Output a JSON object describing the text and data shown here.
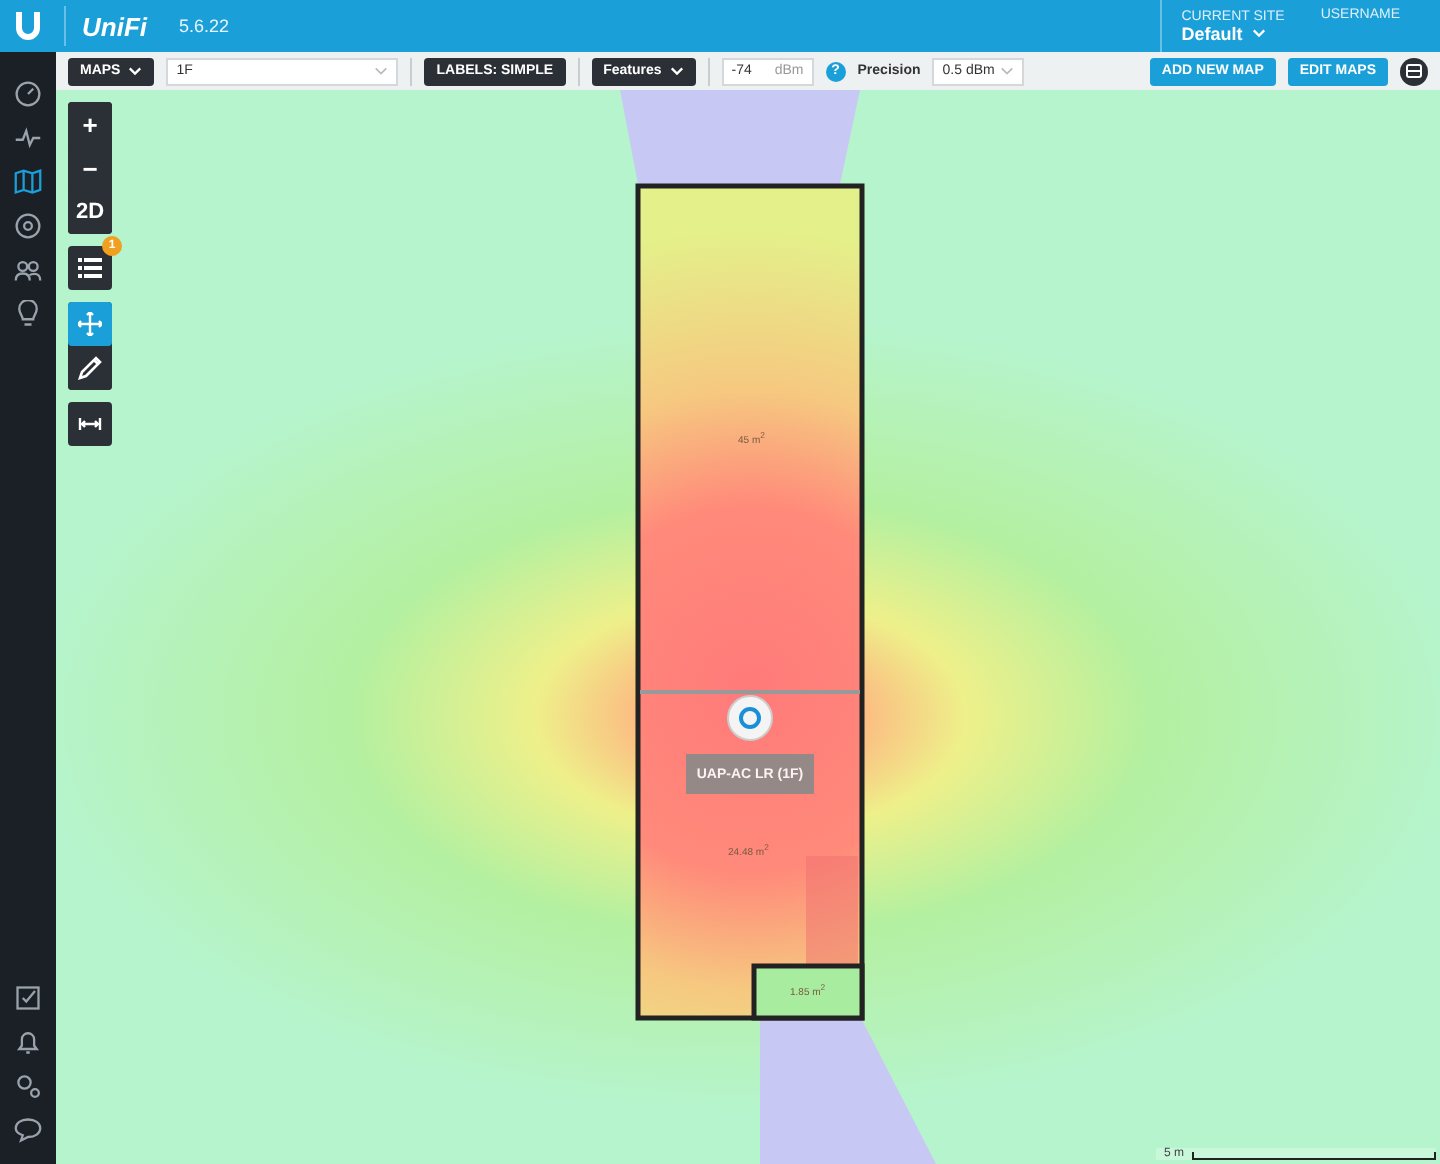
{
  "header": {
    "logo": "UniFi",
    "version": "5.6.22",
    "site_label": "CURRENT SITE",
    "site": "Default",
    "user_label": "USERNAME"
  },
  "nav_top": [
    {
      "selected": false
    },
    {
      "selected": false
    },
    {
      "selected": true
    },
    {
      "selected": false
    },
    {
      "selected": false
    },
    {
      "selected": false
    }
  ],
  "nav_bottom": [
    {
      "selected": false
    },
    {
      "selected": false
    },
    {
      "selected": false
    },
    {
      "selected": false
    }
  ],
  "toolbar": {
    "maps": "MAPS",
    "floor": "1F",
    "labels": "LABELS: SIMPLE",
    "features": "Features",
    "signal": "-74",
    "signal_unit": "dBm",
    "help": "?",
    "precision_label": "Precision",
    "precision": "0.5 dBm",
    "add_map": "ADD NEW MAP",
    "edit_maps": "EDIT MAPS"
  },
  "map_tools": {
    "zoom_in": "+",
    "zoom_out": "−",
    "view": "2D",
    "list_badge": "1",
    "move_selected": true,
    "draw_selected": false
  },
  "rooms": [
    {
      "area": "45 m$^{2}$"
    },
    {
      "area": "24.48 m$^{2}$"
    },
    {
      "area": "1.85 m$^{2}$"
    }
  ],
  "device": {
    "label": "UAP-AC LR (1F)"
  },
  "scale": "5 m"
}
